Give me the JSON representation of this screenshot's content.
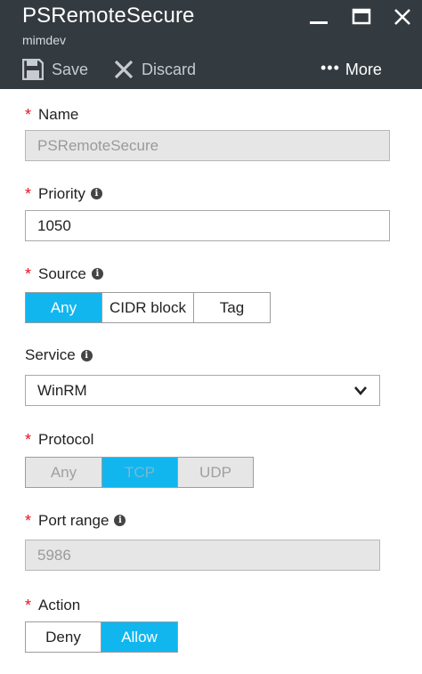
{
  "window": {
    "title": "PSRemoteSecure",
    "subtitle": "mimdev"
  },
  "toolbar": {
    "save_label": "Save",
    "discard_label": "Discard",
    "more_label": "More",
    "more_dots": "•••"
  },
  "form": {
    "required_marker": "*",
    "info_glyph": "i",
    "name": {
      "label": "Name",
      "value": "PSRemoteSecure"
    },
    "priority": {
      "label": "Priority",
      "value": "1050"
    },
    "source": {
      "label": "Source",
      "options": [
        "Any",
        "CIDR block",
        "Tag"
      ],
      "selected": "Any"
    },
    "service": {
      "label": "Service",
      "value": "WinRM"
    },
    "protocol": {
      "label": "Protocol",
      "options": [
        "Any",
        "TCP",
        "UDP"
      ],
      "selected": "TCP"
    },
    "port_range": {
      "label": "Port range",
      "value": "5986"
    },
    "action": {
      "label": "Action",
      "options": [
        "Deny",
        "Allow"
      ],
      "selected": "Allow"
    }
  },
  "colors": {
    "header_bg": "#333a40",
    "accent": "#11b6ef",
    "required": "#e81123",
    "disabled_bg": "#e6e6e6"
  },
  "icons": {
    "save": "save-icon",
    "discard": "discard-icon",
    "minimize": "minimize-icon",
    "maximize": "maximize-icon",
    "close": "close-icon",
    "info": "info-icon",
    "chevron": "chevron-down-icon"
  }
}
